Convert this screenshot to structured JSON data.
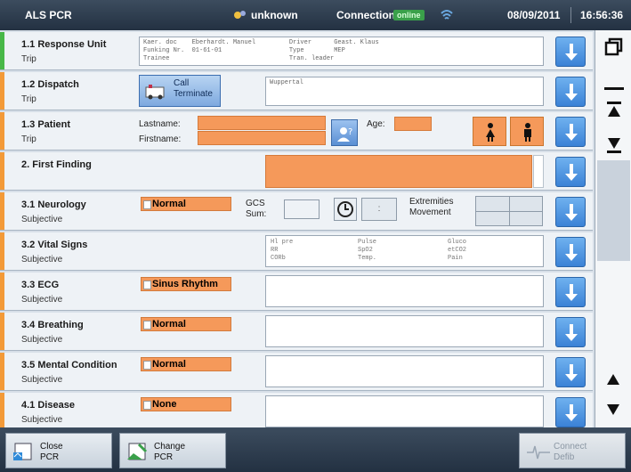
{
  "header": {
    "app_title": "ALS PCR",
    "user": "unknown",
    "connection_label": "Connection:",
    "connection_status": "online",
    "date": "08/09/2011",
    "time": "16:56:36"
  },
  "rows": [
    {
      "title": "1.1 Response Unit",
      "subtitle": "Trip",
      "info_text": "Kaer. doc    Eberhardt. Manuel         Driver      Geast. Klaus\nFunking Nr.  01-61-01                  Type        MEP\nTrainee                                Tran. leader"
    },
    {
      "title": "1.2 Dispatch",
      "subtitle": "Trip",
      "button_label_1": "Call",
      "button_label_2": "Terminate",
      "field_text": "Wuppertal"
    },
    {
      "title": "1.3 Patient",
      "subtitle": "Trip",
      "lastname_label": "Lastname:",
      "firstname_label": "Firstname:",
      "age_label": "Age:"
    },
    {
      "title": "2. First Finding",
      "subtitle": ""
    },
    {
      "title": "3.1 Neurology",
      "subtitle": "Subjective",
      "pill": "Normal",
      "gcs_label_1": "GCS",
      "gcs_label_2": "Sum:",
      "extremities_1": "Extremities",
      "extremities_2": "Movement"
    },
    {
      "title": "3.2 Vital Signs",
      "subtitle": "Subjective",
      "col1": "Hl pre\nRR\nCORb",
      "col2": "Pulse\nSpO2\nTemp.",
      "col3": "Gluco\netCO2\nPain"
    },
    {
      "title": "3.3 ECG",
      "subtitle": "Subjective",
      "pill": "Sinus Rhythm"
    },
    {
      "title": "3.4 Breathing",
      "subtitle": "Subjective",
      "pill": "Normal"
    },
    {
      "title": "3.5 Mental Condition",
      "subtitle": "Subjective",
      "pill": "Normal"
    },
    {
      "title": "4.1 Disease",
      "subtitle": "Subjective",
      "pill": "None"
    }
  ],
  "footer": {
    "close_1": "Close",
    "close_2": "PCR",
    "change_1": "Change",
    "change_2": "PCR",
    "connect_1": "Connect",
    "connect_2": "Defib"
  },
  "colors": {
    "accent_orange": "#f5995a",
    "arrow_blue": "#3b82d6",
    "status_green": "#48b848"
  }
}
